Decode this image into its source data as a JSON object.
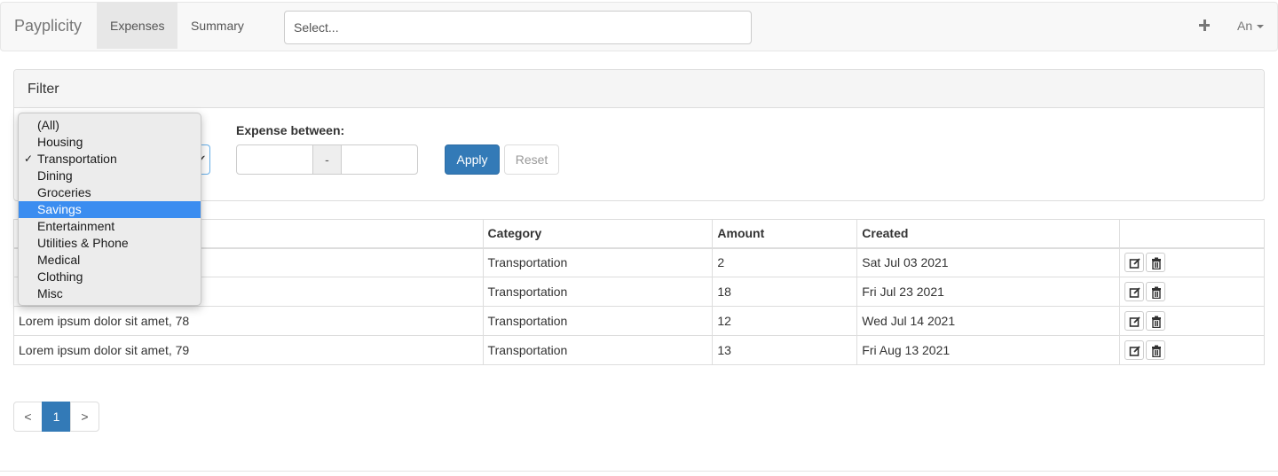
{
  "navbar": {
    "brand": "Payplicity",
    "tabs": [
      {
        "label": "Expenses",
        "active": true
      },
      {
        "label": "Summary",
        "active": false
      }
    ],
    "search_placeholder": "Select...",
    "add_icon": "plus-icon",
    "user": "An"
  },
  "filter": {
    "title": "Filter",
    "expense_label": "Expense between:",
    "range_separator": "-",
    "apply_label": "Apply",
    "reset_label": "Reset",
    "category_options": [
      {
        "label": "(All)",
        "selected": false,
        "highlighted": false
      },
      {
        "label": "Housing",
        "selected": false,
        "highlighted": false
      },
      {
        "label": "Transportation",
        "selected": true,
        "highlighted": false
      },
      {
        "label": "Dining",
        "selected": false,
        "highlighted": false
      },
      {
        "label": "Groceries",
        "selected": false,
        "highlighted": false
      },
      {
        "label": "Savings",
        "selected": false,
        "highlighted": true
      },
      {
        "label": "Entertainment",
        "selected": false,
        "highlighted": false
      },
      {
        "label": "Utilities & Phone",
        "selected": false,
        "highlighted": false
      },
      {
        "label": "Medical",
        "selected": false,
        "highlighted": false
      },
      {
        "label": "Clothing",
        "selected": false,
        "highlighted": false
      },
      {
        "label": "Misc",
        "selected": false,
        "highlighted": false
      }
    ],
    "check_mark": "✓"
  },
  "table": {
    "headers": [
      "",
      "Category",
      "Amount",
      "Created",
      ""
    ],
    "rows": [
      {
        "description": "",
        "category": "Transportation",
        "amount": "2",
        "created": "Sat Jul 03 2021"
      },
      {
        "description": "",
        "category": "Transportation",
        "amount": "18",
        "created": "Fri Jul 23 2021"
      },
      {
        "description": "Lorem ipsum dolor sit amet, 78",
        "category": "Transportation",
        "amount": "12",
        "created": "Wed Jul 14 2021"
      },
      {
        "description": "Lorem ipsum dolor sit amet, 79",
        "category": "Transportation",
        "amount": "13",
        "created": "Fri Aug 13 2021"
      }
    ],
    "row_actions": [
      "edit-icon",
      "trash-icon"
    ]
  },
  "pagination": {
    "prev": "<",
    "pages": [
      "1"
    ],
    "current": "1",
    "next": ">"
  },
  "colors": {
    "primary": "#337ab7",
    "highlight": "#3b8df0"
  }
}
